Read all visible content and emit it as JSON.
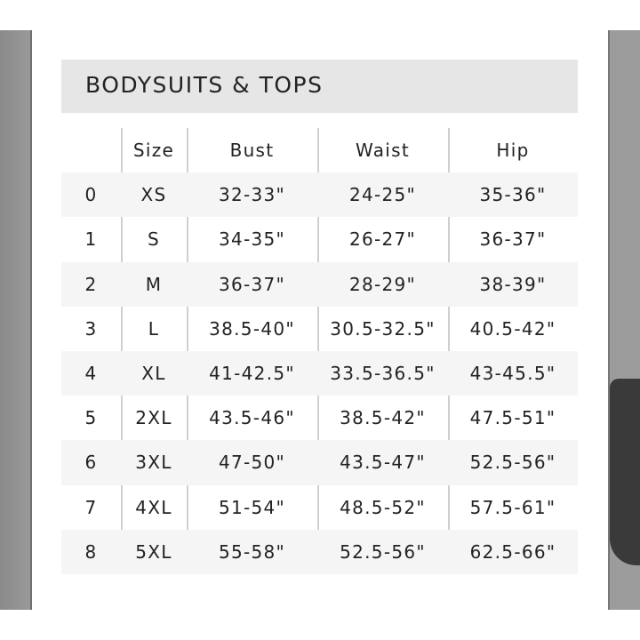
{
  "title": "BODYSUITS & TOPS",
  "columns": [
    "",
    "Size",
    "Bust",
    "Waist",
    "Hip"
  ],
  "rows": [
    [
      "0",
      "XS",
      "32-33\"",
      "24-25\"",
      "35-36\""
    ],
    [
      "1",
      "S",
      "34-35\"",
      "26-27\"",
      "36-37\""
    ],
    [
      "2",
      "M",
      "36-37\"",
      "28-29\"",
      "38-39\""
    ],
    [
      "3",
      "L",
      "38.5-40\"",
      "30.5-32.5\"",
      "40.5-42\""
    ],
    [
      "4",
      "XL",
      "41-42.5\"",
      "33.5-36.5\"",
      "43-45.5\""
    ],
    [
      "5",
      "2XL",
      "43.5-46\"",
      "38.5-42\"",
      "47.5-51\""
    ],
    [
      "6",
      "3XL",
      "47-50\"",
      "43.5-47\"",
      "52.5-56\""
    ],
    [
      "7",
      "4XL",
      "51-54\"",
      "48.5-52\"",
      "57.5-61\""
    ],
    [
      "8",
      "5XL",
      "55-58\"",
      "52.5-56\"",
      "62.5-66\""
    ]
  ],
  "colors": {
    "title_bar": "#e6e6e6",
    "shaded_row": "#f5f5f5",
    "divider": "#cfcfcf",
    "frame": "#9a9a9a"
  }
}
